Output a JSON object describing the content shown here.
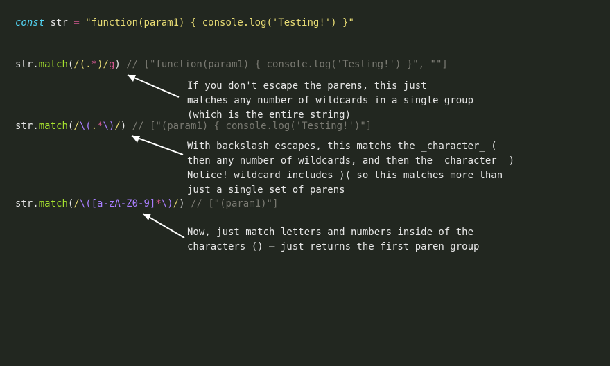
{
  "line1": {
    "keyword": "const",
    "ident": " str ",
    "op": "=",
    "string": " \"function(param1) { console.log('Testing!') }\""
  },
  "ex1": {
    "pre": "str",
    "dot": ".",
    "method": "match",
    "open": "(",
    "r_open": "/",
    "r_lp": "(",
    "r_dot": ".",
    "r_star": "*",
    "r_rp": ")",
    "r_close": "/",
    "flag": "g",
    "close": ") ",
    "comment": "// [\"function(param1) { console.log('Testing!') }\", \"\"]",
    "anno": "If you don't escape the parens, this just\nmatches any number of wildcards in a single group\n(which is the entire string)"
  },
  "ex2": {
    "pre": "str",
    "dot": ".",
    "method": "match",
    "open": "(",
    "r_open": "/",
    "esc1": "\\(",
    "r_dot": ".",
    "r_star": "*",
    "esc2": "\\)",
    "r_close": "/",
    "close": ") ",
    "comment": "// [\"(param1) { console.log('Testing!')\"]",
    "anno": "With backslash escapes, this matchs the _character_ (\nthen any number of wildcards, and then the _character_ )\nNotice! wildcard includes )( so this matches more than\njust a single set of parens"
  },
  "ex3": {
    "pre": "str",
    "dot": ".",
    "method": "match",
    "open": "(",
    "r_open": "/",
    "esc1": "\\(",
    "charcls": "[a-zA-Z0-9]",
    "r_star": "*",
    "esc2": "\\)",
    "r_close": "/",
    "close": ") ",
    "comment": "// [\"(param1)\"]",
    "anno": "Now, just match letters and numbers inside of the\ncharacters () – just returns the first paren group"
  }
}
